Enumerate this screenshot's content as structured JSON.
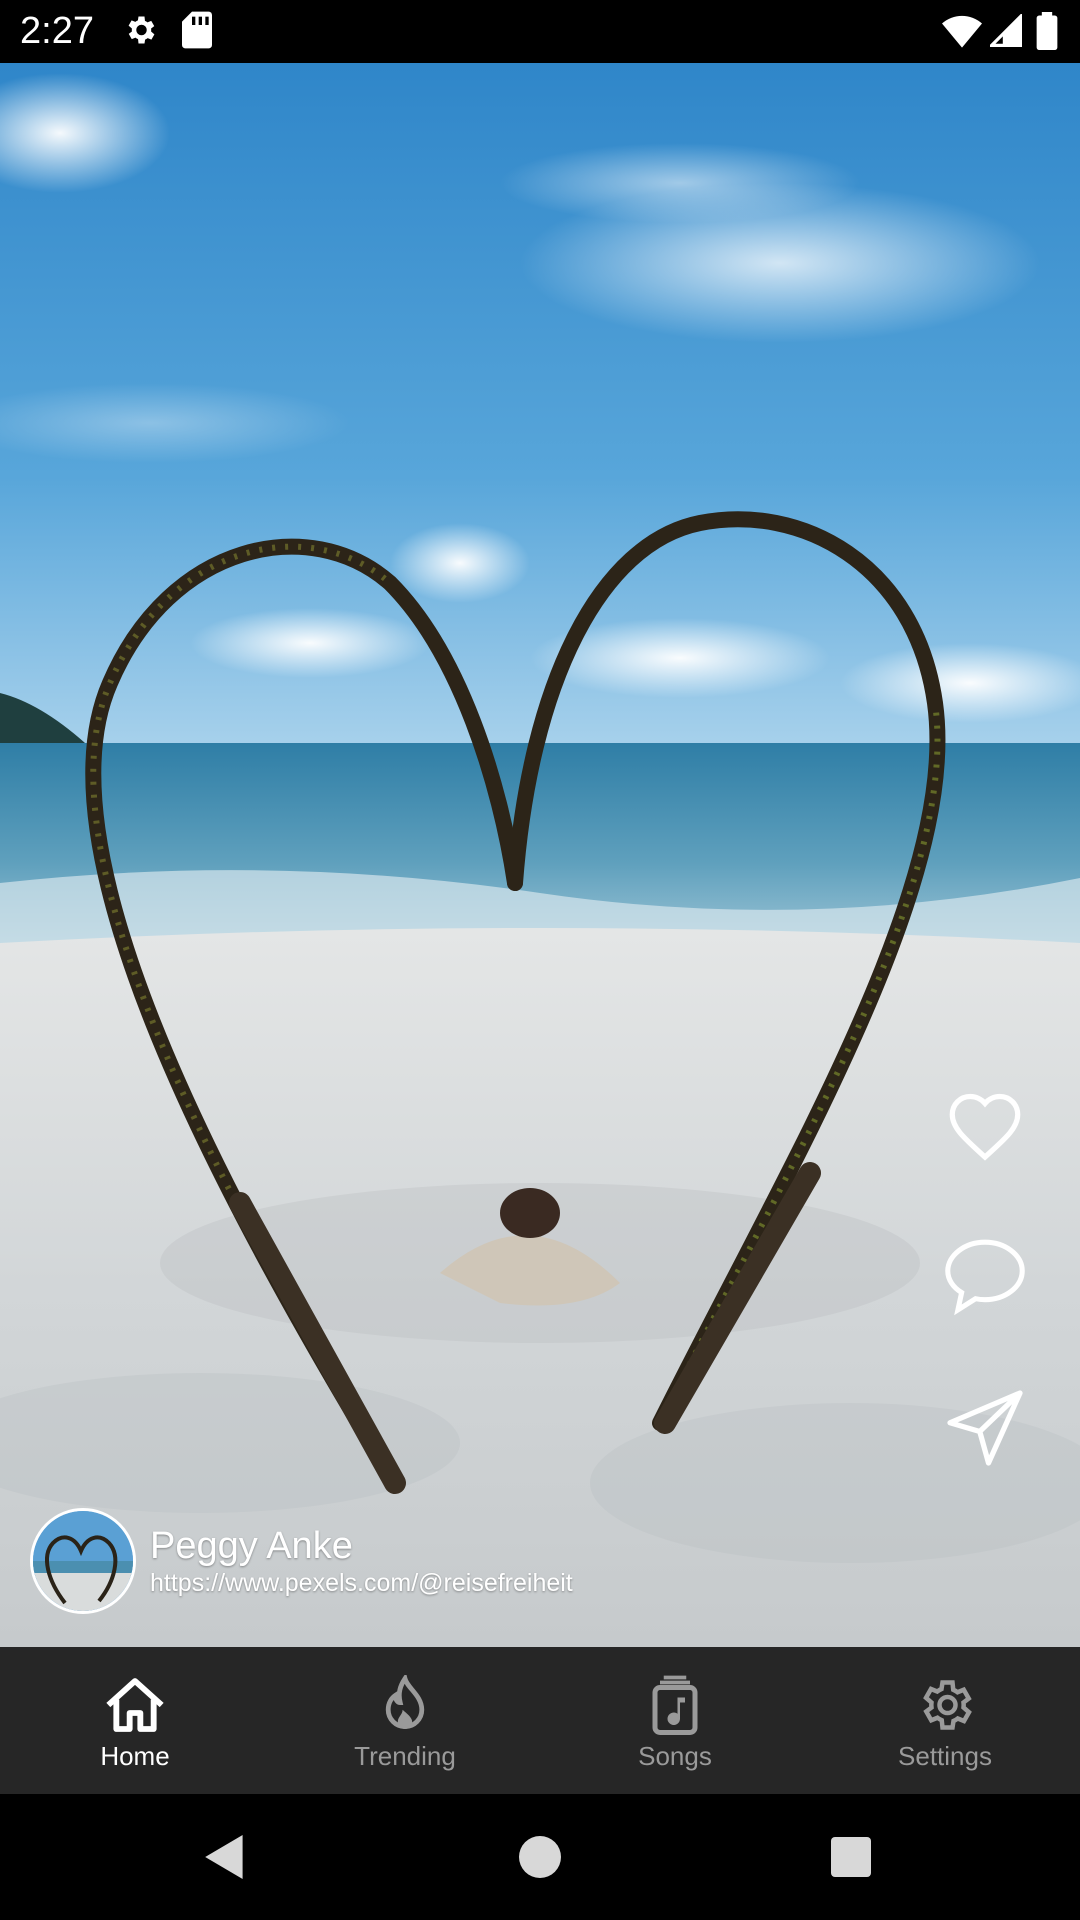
{
  "status_bar": {
    "time": "2:27",
    "icons": [
      "gear-icon",
      "sd-card-icon",
      "wifi-icon",
      "cell-signal-icon",
      "battery-icon"
    ]
  },
  "video": {
    "description_icon": "heart-palm-beach-scene"
  },
  "actions": {
    "like_icon": "heart-outline-icon",
    "comment_icon": "comment-bubble-icon",
    "share_icon": "send-icon"
  },
  "author": {
    "name": "Peggy Anke",
    "link": "https://www.pexels.com/@reisefreiheit"
  },
  "bottom_nav": {
    "items": [
      {
        "label": "Home",
        "icon": "home-icon",
        "active": true
      },
      {
        "label": "Trending",
        "icon": "flame-icon",
        "active": false
      },
      {
        "label": "Songs",
        "icon": "music-note-icon",
        "active": false
      },
      {
        "label": "Settings",
        "icon": "settings-icon",
        "active": false
      }
    ]
  },
  "system_nav": {
    "icons": [
      "back-icon",
      "home-circle-icon",
      "recents-icon"
    ]
  },
  "colors": {
    "nav_background": "#262626",
    "nav_active": "#ffffff",
    "nav_inactive": "#9a9a9a",
    "sky": "#3f93cf",
    "sand": "#d9dcde"
  }
}
